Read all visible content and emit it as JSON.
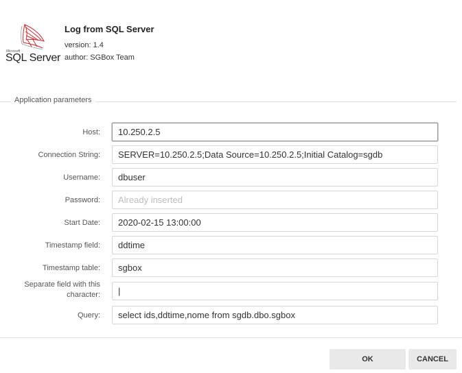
{
  "app": {
    "title": "Log from SQL Server",
    "version": "version: 1.4",
    "author": "author: SGBox Team",
    "logo_small": "Microsoft",
    "logo_text": "SQL Server"
  },
  "section": {
    "legend": "Application parameters"
  },
  "fields": {
    "host": {
      "label": "Host:",
      "value": "10.250.2.5"
    },
    "connection_string": {
      "label": "Connection String:",
      "value": "SERVER=10.250.2.5;Data Source=10.250.2.5;Initial Catalog=sgdb"
    },
    "username": {
      "label": "Username:",
      "value": "dbuser"
    },
    "password": {
      "label": "Password:",
      "value": "",
      "placeholder": "Already inserted"
    },
    "start_date": {
      "label": "Start Date:",
      "value": "2020-02-15 13:00:00"
    },
    "timestamp_field": {
      "label": "Timestamp field:",
      "value": "ddtime"
    },
    "timestamp_table": {
      "label": "Timestamp table:",
      "value": "sgbox"
    },
    "separator": {
      "label": "Separate field with this character:",
      "value": "|"
    },
    "query": {
      "label": "Query:",
      "value": "select ids,ddtime,nome from sgdb.dbo.sgbox"
    }
  },
  "buttons": {
    "ok": "OK",
    "cancel": "CANCEL"
  }
}
